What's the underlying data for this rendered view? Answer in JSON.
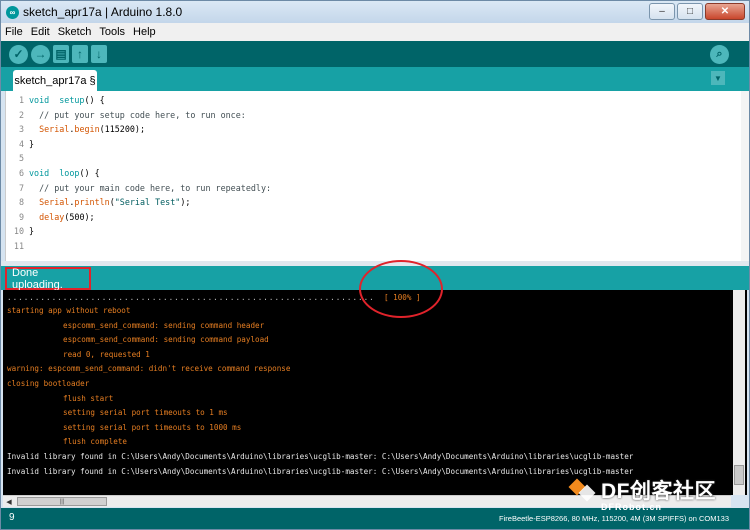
{
  "window": {
    "title": "sketch_apr17a | Arduino 1.8.0",
    "controls": [
      "–",
      "□",
      "✕"
    ]
  },
  "menu": [
    "File",
    "Edit",
    "Sketch",
    "Tools",
    "Help"
  ],
  "toolbar": {
    "verify_icon": "✓",
    "upload_icon": "→",
    "new_icon": "▤",
    "open_icon": "↑",
    "save_icon": "↓",
    "serial_icon": "⌕"
  },
  "tab": {
    "label": "sketch_apr17a §",
    "menu_icon": "▼"
  },
  "editor": {
    "lines": [
      {
        "n": "1",
        "parts": [
          [
            "kw",
            "void"
          ],
          [
            "",
            "  "
          ],
          [
            "kw",
            "setup"
          ],
          [
            "",
            "() {"
          ]
        ]
      },
      {
        "n": "2",
        "parts": [
          [
            "cm",
            "  // put your setup code here, to run once:"
          ]
        ]
      },
      {
        "n": "3",
        "parts": [
          [
            "",
            "  "
          ],
          [
            "fn",
            "Serial"
          ],
          [
            "",
            "."
          ],
          [
            "fn",
            "begin"
          ],
          [
            "",
            "(115200);"
          ]
        ]
      },
      {
        "n": "4",
        "parts": [
          [
            "",
            "}"
          ]
        ]
      },
      {
        "n": "5",
        "parts": [
          [
            "",
            ""
          ]
        ]
      },
      {
        "n": "6",
        "parts": [
          [
            "kw",
            "void"
          ],
          [
            "",
            "  "
          ],
          [
            "kw",
            "loop"
          ],
          [
            "",
            "() {"
          ]
        ]
      },
      {
        "n": "7",
        "parts": [
          [
            "cm",
            "  // put your main code here, to run repeatedly:"
          ]
        ]
      },
      {
        "n": "8",
        "parts": [
          [
            "",
            "  "
          ],
          [
            "fn",
            "Serial"
          ],
          [
            "",
            "."
          ],
          [
            "fn",
            "println"
          ],
          [
            "",
            "("
          ],
          [
            "st",
            "\"Serial Test\""
          ],
          [
            "",
            ");"
          ]
        ]
      },
      {
        "n": "9",
        "parts": [
          [
            "",
            "  "
          ],
          [
            "fn",
            "delay"
          ],
          [
            "",
            "(500);"
          ]
        ]
      },
      {
        "n": "10",
        "parts": [
          [
            "",
            "}"
          ]
        ]
      },
      {
        "n": "11",
        "parts": [
          [
            "",
            ""
          ]
        ]
      }
    ]
  },
  "status": {
    "message": "Done uploading."
  },
  "console": {
    "dots": "..................................................................",
    "percent": "[ 100% ]",
    "lines": [
      {
        "text": "starting app without reboot",
        "indent": 0,
        "color": "orange"
      },
      {
        "text": "espcomm_send_command: sending command header",
        "indent": 1,
        "color": "orange"
      },
      {
        "text": "espcomm_send_command: sending command payload",
        "indent": 1,
        "color": "orange"
      },
      {
        "text": "read 0, requested 1",
        "indent": 1,
        "color": "orange"
      },
      {
        "text": "warning: espcomm_send_command: didn't receive command response",
        "indent": 0,
        "color": "orange"
      },
      {
        "text": "closing bootloader",
        "indent": 0,
        "color": "orange"
      },
      {
        "text": "flush start",
        "indent": 1,
        "color": "orange"
      },
      {
        "text": "setting serial port timeouts to 1 ms",
        "indent": 1,
        "color": "orange"
      },
      {
        "text": "setting serial port timeouts to 1000 ms",
        "indent": 1,
        "color": "orange"
      },
      {
        "text": "flush complete",
        "indent": 1,
        "color": "orange"
      },
      {
        "text": "Invalid library found in C:\\Users\\Andy\\Documents\\Arduino\\libraries\\ucglib-master: C:\\Users\\Andy\\Documents\\Arduino\\libraries\\ucglib-master",
        "indent": 0,
        "color": "white"
      },
      {
        "text": "Invalid library found in C:\\Users\\Andy\\Documents\\Arduino\\libraries\\ucglib-master: C:\\Users\\Andy\\Documents\\Arduino\\libraries\\ucglib-master",
        "indent": 0,
        "color": "white"
      }
    ]
  },
  "bottom": {
    "line_number": "9",
    "board": "FireBeetle-ESP8266, 80 MHz, 115200, 4M (3M SPIFFS) on COM133"
  },
  "watermark": {
    "text": "DF创客社区",
    "sub": "DFRobot.cn"
  },
  "colors": {
    "teal_dark": "#006468",
    "teal": "#17a1a5",
    "highlight_red": "#e0232b",
    "console_orange": "#e67e22"
  }
}
